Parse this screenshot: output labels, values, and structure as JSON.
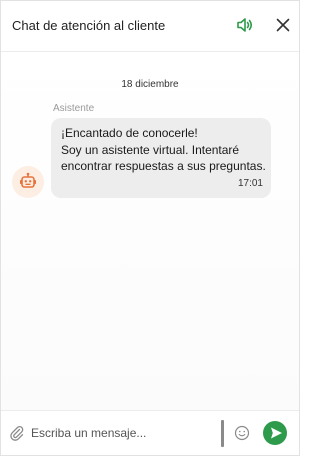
{
  "header": {
    "title": "Chat de atención al cliente",
    "sound_icon": "speaker-volume-icon",
    "close_icon": "close-icon"
  },
  "conversation": {
    "date": "18 diciembre",
    "sender": "Asistente",
    "avatar_icon": "robot-icon",
    "message": {
      "lines": [
        "¡Encantado de conocerle!",
        "Soy un asistente virtual. Intentaré",
        "encontrar respuestas a sus preguntas."
      ],
      "time": "17:01"
    }
  },
  "composer": {
    "placeholder": "Escriba un mensaje...",
    "value": "",
    "attach_icon": "paperclip-icon",
    "emoji_icon": "smiley-icon",
    "send_icon": "send-icon"
  },
  "colors": {
    "accent": "#2e9a4b",
    "avatar_bg": "#fdeee4",
    "avatar_fg": "#e8733a",
    "bubble_bg": "#ededee"
  }
}
